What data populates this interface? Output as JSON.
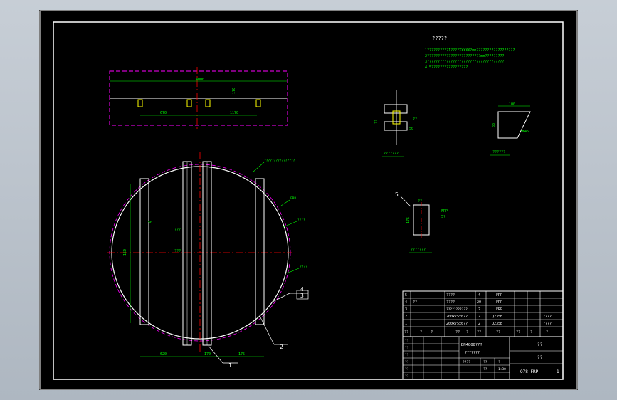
{
  "drawing": {
    "notes": {
      "title": "?????",
      "lines": [
        "1??????????1????XXXXX?mm??????????????????",
        "2?????????????????????????mm?????????",
        "3????????????????????????????????????",
        "4.5?????????????????"
      ]
    },
    "top_view": {
      "dim_overall": "4000",
      "dim_left": "670",
      "dim_right": "1170",
      "dim_vertical": "170"
    },
    "plan_view": {
      "callouts": [
        "????????????????",
        "FRP",
        "????",
        "????"
      ],
      "part_marks": [
        "1",
        "2",
        "3",
        "4"
      ],
      "dims": [
        "620",
        "170",
        "175",
        "150",
        "???",
        "???",
        "150"
      ]
    },
    "detail_a": {
      "caption": "???????",
      "dims": [
        "??",
        "??",
        "50"
      ]
    },
    "detail_b": {
      "caption": "??????",
      "dims": [
        "100",
        "88",
        "3m45"
      ]
    },
    "detail_c": {
      "caption": "???????",
      "mark": "5",
      "dims": [
        "175",
        "??",
        "FRP",
        "5?"
      ]
    },
    "bom": {
      "rows": [
        {
          "no": "5",
          "code": "",
          "name": "????",
          "qty": "4",
          "mat": "FRP"
        },
        {
          "no": "4",
          "code": "??",
          "name": "????",
          "qty": "20",
          "mat": "FRP"
        },
        {
          "no": "3",
          "code": "",
          "name": "???????????",
          "qty": "2",
          "mat": "FRP",
          "note": ""
        },
        {
          "no": "2",
          "code": "",
          "name": "200x75x6??",
          "qty": "2",
          "mat": "Q235B",
          "note": "????"
        },
        {
          "no": "1",
          "code": "",
          "name": "200x75x6??",
          "qty": "2",
          "mat": "Q235B",
          "note": "????"
        }
      ],
      "header": [
        "??",
        "?",
        "?",
        "??",
        "?",
        "??",
        "??",
        "??",
        "?",
        "?"
      ]
    },
    "title_block": {
      "center_line1": "DN4000???",
      "center_line2": "???????",
      "right_top": "??",
      "right_mid": "??",
      "drawing_no": "Q78-FRP",
      "sheet": "1",
      "sign_rows": [
        "??",
        "??",
        "??",
        "??",
        "??",
        "??"
      ],
      "mid_labels": [
        "????",
        "??",
        "?",
        "??",
        "1:30"
      ]
    },
    "colors": {
      "background": "#000000",
      "frame": "#ffffff",
      "outline": "#ffffff",
      "centerline": "#ff0000",
      "hidden": "#ff00ff",
      "dimension": "#00ff00",
      "highlight": "#ffff00",
      "cyan": "#00ffff"
    }
  }
}
